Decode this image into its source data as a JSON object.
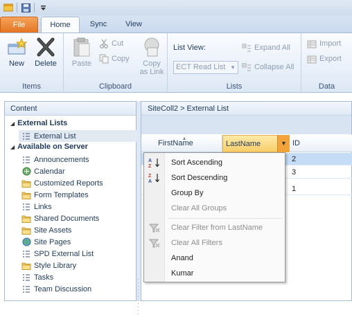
{
  "qat": {
    "icons": [
      "app-icon",
      "save-icon",
      "customize-qat-icon"
    ]
  },
  "tabs": [
    {
      "label": "File"
    },
    {
      "label": "Home"
    },
    {
      "label": "Sync"
    },
    {
      "label": "View"
    }
  ],
  "ribbon": {
    "items": {
      "group_label": "Items",
      "new_label": "New",
      "delete_label": "Delete"
    },
    "clipboard": {
      "group_label": "Clipboard",
      "paste_label": "Paste",
      "cut_label": "Cut",
      "copy_label": "Copy",
      "copy_link_label_1": "Copy",
      "copy_link_label_2": "as Link"
    },
    "lists": {
      "group_label": "Lists",
      "list_view_label": "List View:",
      "list_view_value": "ECT Read List",
      "expand_all_label": "Expand All",
      "collapse_all_label": "Collapse All"
    },
    "data": {
      "group_label": "Data",
      "import_label": "Import",
      "export_label": "Export"
    }
  },
  "left_panel": {
    "header": "Content",
    "external_lists_heading": "External Lists",
    "external_lists": [
      {
        "label": "External List",
        "icon": "list-icon"
      }
    ],
    "available_heading": "Available on Server",
    "available": [
      {
        "label": "Announcements",
        "icon": "list-icon"
      },
      {
        "label": "Calendar",
        "icon": "calendar-icon"
      },
      {
        "label": "Customized Reports",
        "icon": "folder-icon"
      },
      {
        "label": "Form Templates",
        "icon": "folder-icon"
      },
      {
        "label": "Links",
        "icon": "list-icon"
      },
      {
        "label": "Shared Documents",
        "icon": "folder-icon"
      },
      {
        "label": "Site Assets",
        "icon": "folder-icon"
      },
      {
        "label": "Site Pages",
        "icon": "globe-icon"
      },
      {
        "label": "SPD External List",
        "icon": "list-icon"
      },
      {
        "label": "Style Library",
        "icon": "folder-icon"
      },
      {
        "label": "Tasks",
        "icon": "list-icon"
      },
      {
        "label": "Team Discussion",
        "icon": "list-icon"
      }
    ]
  },
  "right_panel": {
    "breadcrumb": "SiteColl2 > External List",
    "columns": [
      "FirstName",
      "LastName",
      "ID"
    ],
    "rows": [
      {
        "id": "2",
        "selected": true
      },
      {
        "id": "3",
        "selected": false
      },
      {
        "id": "1",
        "selected": false
      }
    ]
  },
  "context_menu": {
    "sort_ascending": "Sort Ascending",
    "sort_descending": "Sort Descending",
    "group_by": "Group By",
    "clear_all_groups": "Clear All Groups",
    "clear_filter": "Clear Filter from LastName",
    "clear_all_filters": "Clear All Filters",
    "values": [
      "Anand",
      "Kumar"
    ]
  },
  "colors": {
    "file_tab": "#e2721e",
    "selected_row": "#c5dcf7",
    "active_column": "#f8cf6b"
  }
}
